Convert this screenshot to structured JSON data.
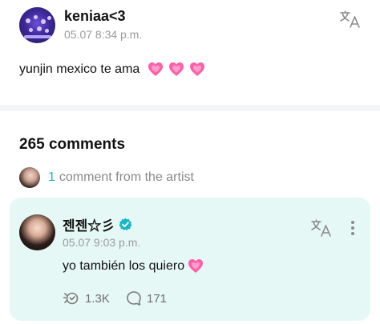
{
  "post": {
    "author": "keniaa<3",
    "timestamp": "05.07 8:34 p.m.",
    "text": "yunjin mexico te ama",
    "emojis": [
      "growing-heart",
      "growing-heart",
      "growing-heart"
    ],
    "translate_icon": "translate-icon"
  },
  "comments": {
    "title": "265 comments",
    "artist_summary": {
      "count": "1",
      "label": "comment from the artist"
    }
  },
  "artist_comment": {
    "author": "젠젠☆彡",
    "timestamp": "05.07 9:03 p.m.",
    "text": "yo también los quiero",
    "emoji": "growing-heart",
    "verified_icon": "verified-badge-icon",
    "likes": "1.3K",
    "replies": "171"
  },
  "colors": {
    "accent": "#19b5c6",
    "card_bg": "#e6f8f5",
    "muted": "#9a9a9a",
    "heart_pink": "#ff5fa8"
  }
}
